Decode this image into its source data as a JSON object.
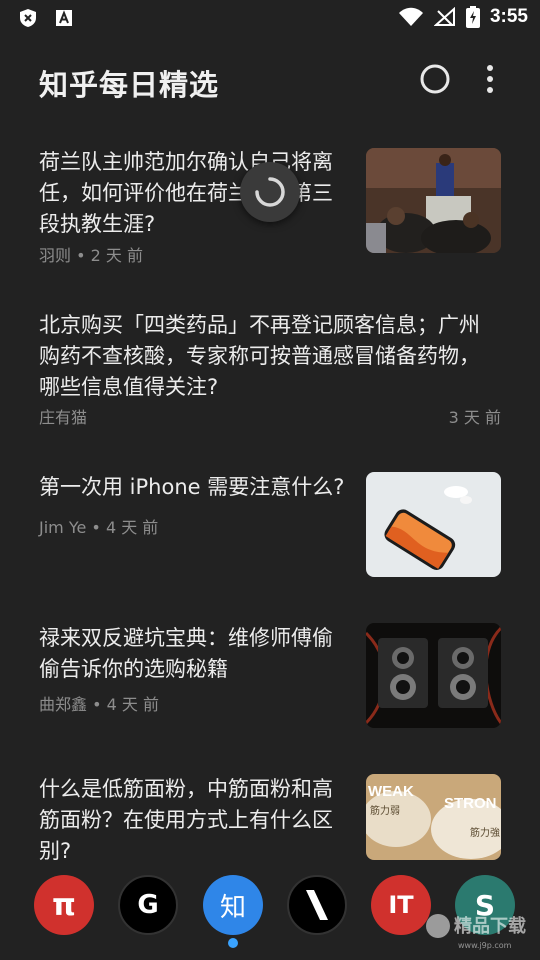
{
  "status_bar": {
    "time": "3:55",
    "left_icons": [
      "shield-x-icon",
      "font-a-icon"
    ],
    "right_icons": [
      "wifi-icon",
      "no-signal-icon",
      "battery-charging-icon"
    ]
  },
  "app_bar": {
    "title": "知乎每日精选",
    "actions": [
      "circle-icon",
      "more-vert-icon"
    ]
  },
  "feed": {
    "items": [
      {
        "title_lines": [
          "荷兰队主帅范加尔确认自己将离",
          "任，如何评价他在荷兰队的第三",
          "段执教生涯?"
        ],
        "author": "羽则",
        "time": "2 天 前",
        "meta": "羽则 • 2 天 前",
        "has_thumb": true,
        "thumb": "thumb-press-conference"
      },
      {
        "title_lines": [
          "北京购买「四类药品」不再登记顾客信息；广州",
          "购药不查核酸，专家称可按普通感冒储备药物，",
          "哪些信息值得关注?"
        ],
        "author": "庄有猫",
        "time": "3 天 前",
        "has_thumb": false
      },
      {
        "title_lines": [
          "第一次用 iPhone 需要注意什么?"
        ],
        "author": "Jim Ye",
        "time": "4 天 前",
        "meta": "Jim Ye • 4 天 前",
        "has_thumb": true,
        "thumb": "thumb-iphone"
      },
      {
        "title_lines": [
          "禄来双反避坑宝典：维修师傅偷",
          "偷告诉你的选购秘籍"
        ],
        "author": "曲郑鑫",
        "time": "4 天 前",
        "meta": "曲郑鑫 • 4 天 前",
        "has_thumb": true,
        "thumb": "thumb-cameras"
      },
      {
        "title_lines": [
          "什么是低筋面粉，中筋面粉和高",
          "筋面粉？在使用方式上有什么区",
          "别?"
        ],
        "has_thumb": true,
        "thumb": "thumb-flour",
        "thumb_labels": [
          "WEAK",
          "STRON",
          "筋力弱",
          "筋力強"
        ]
      }
    ]
  },
  "bottom_nav": {
    "sources": [
      {
        "label": "π",
        "color": "#d0312d"
      },
      {
        "label": "G",
        "color": "#000000"
      },
      {
        "label": "知",
        "color": "#2f86e8",
        "active": true
      },
      {
        "label": "\\",
        "color": "#000000"
      },
      {
        "label": "IT",
        "color": "#d0312d"
      },
      {
        "label": "S",
        "color": "#2b7a6f"
      }
    ]
  },
  "watermark": {
    "text": "精品下载",
    "sub": "www.j9p.com"
  }
}
